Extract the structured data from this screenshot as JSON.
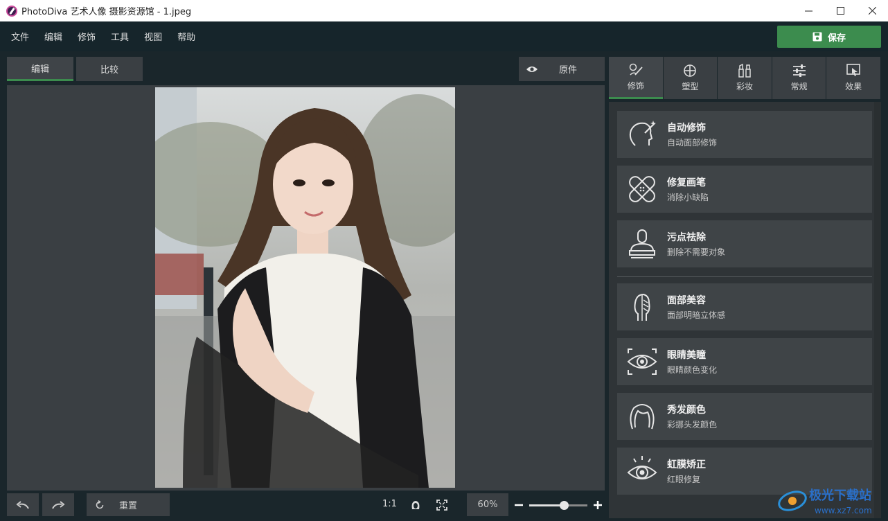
{
  "window": {
    "title": "PhotoDiva 艺术人像 摄影资源馆 - 1.jpeg",
    "controls": [
      "minimize",
      "maximize",
      "close"
    ]
  },
  "menu": {
    "items": [
      "文件",
      "编辑",
      "修饰",
      "工具",
      "视图",
      "帮助"
    ],
    "save_label": "保存"
  },
  "editor": {
    "tabs": [
      "编辑",
      "比较"
    ],
    "active_tab": "编辑",
    "original_label": "原件"
  },
  "bottom": {
    "reset_label": "重置",
    "ratio_label": "1:1",
    "zoom_value": "60%",
    "zoom_level": 0.6
  },
  "right_tabs": [
    {
      "label": "修饰",
      "icon": "brush-icon"
    },
    {
      "label": "塑型",
      "icon": "reshape-icon"
    },
    {
      "label": "彩妆",
      "icon": "makeup-icon"
    },
    {
      "label": "常规",
      "icon": "sliders-icon"
    },
    {
      "label": "效果",
      "icon": "effects-icon"
    }
  ],
  "tools": [
    {
      "name": "自动修饰",
      "desc": "自动面部修饰",
      "icon": "auto-retouch-icon"
    },
    {
      "name": "修复画笔",
      "desc": "消除小缺陷",
      "icon": "bandage-icon"
    },
    {
      "name": "污点祛除",
      "desc": "删除不需要对象",
      "icon": "stamp-icon"
    },
    {
      "name": "面部美容",
      "desc": "面部明暗立体感",
      "icon": "face-contour-icon"
    },
    {
      "name": "眼睛美瞳",
      "desc": "眼睛颜色变化",
      "icon": "eye-focus-icon"
    },
    {
      "name": "秀发颜色",
      "desc": "彩挪头发颜色",
      "icon": "hair-icon"
    },
    {
      "name": "虹膜矫正",
      "desc": "红眼修复",
      "icon": "iris-icon"
    }
  ],
  "watermark": {
    "text1": "极光下载站",
    "text2": "www.xz7.com"
  },
  "colors": {
    "accent": "#3c8c4e",
    "panel": "#3a3f43",
    "background": "#1a262b"
  }
}
